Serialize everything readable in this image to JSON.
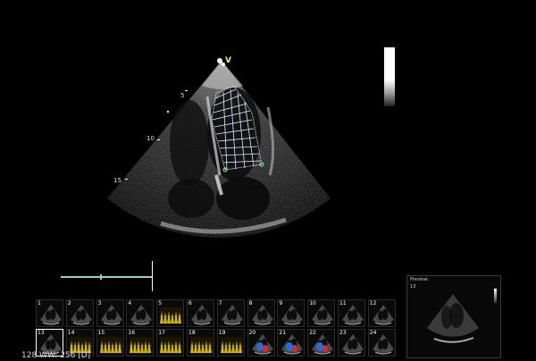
{
  "depth_markers": [
    "5",
    "10",
    "15"
  ],
  "apex_marker": "V",
  "thumbnails": [
    {
      "num": "1",
      "type": "bw"
    },
    {
      "num": "2",
      "type": "bw"
    },
    {
      "num": "3",
      "type": "bw"
    },
    {
      "num": "4",
      "type": "bw"
    },
    {
      "num": "5",
      "type": "doppler"
    },
    {
      "num": "6",
      "type": "bw"
    },
    {
      "num": "7",
      "type": "bw"
    },
    {
      "num": "8",
      "type": "bw"
    },
    {
      "num": "9",
      "type": "bw"
    },
    {
      "num": "10",
      "type": "bw"
    },
    {
      "num": "11",
      "type": "bw"
    },
    {
      "num": "12",
      "type": "bw"
    },
    {
      "num": "13",
      "type": "bw"
    },
    {
      "num": "14",
      "type": "doppler"
    },
    {
      "num": "15",
      "type": "doppler"
    },
    {
      "num": "16",
      "type": "doppler"
    },
    {
      "num": "17",
      "type": "doppler"
    },
    {
      "num": "18",
      "type": "doppler"
    },
    {
      "num": "19",
      "type": "doppler"
    },
    {
      "num": "20",
      "type": "color"
    },
    {
      "num": "21",
      "type": "color"
    },
    {
      "num": "22",
      "type": "color"
    },
    {
      "num": "23",
      "type": "bw"
    },
    {
      "num": "24",
      "type": "bw"
    }
  ],
  "selected_thumbnail": "13",
  "status": {
    "text": "128 WW: 256 [D]"
  },
  "preview": {
    "title": "Preview:",
    "number": "13"
  },
  "colors": {
    "background": "#000000",
    "tracing": "#dfe8ff",
    "marker": "#e8ff70",
    "scale": "#8fd4c4",
    "doppler": "#e3c61b",
    "flow_red": "#d62c2c",
    "flow_blue": "#2a6bd9"
  }
}
